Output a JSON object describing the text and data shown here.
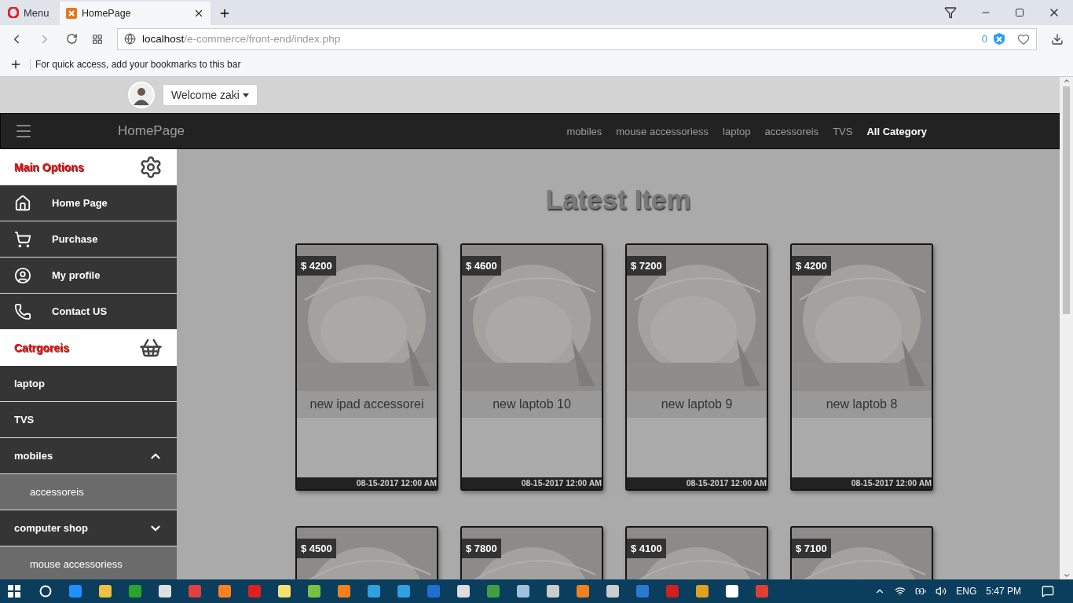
{
  "browser": {
    "menu_label": "Menu",
    "tab": {
      "title": "HomePage"
    },
    "address": {
      "host": "localhost",
      "path": "/e-commerce/front-end/index.php"
    },
    "blocked_count": "0",
    "bookmarks_hint": "For quick access, add your bookmarks to this bar"
  },
  "user_menu": {
    "label": "Welcome zaki"
  },
  "navbar": {
    "brand": "HomePage",
    "links": [
      {
        "label": "mobiles",
        "selected": false
      },
      {
        "label": "mouse accessoriess",
        "selected": false
      },
      {
        "label": "laptop",
        "selected": false
      },
      {
        "label": "accessoreis",
        "selected": false
      },
      {
        "label": "TVS",
        "selected": false
      },
      {
        "label": "All Category",
        "selected": true
      }
    ]
  },
  "sidebar": [
    {
      "kind": "heading",
      "label": "Main Options"
    },
    {
      "kind": "option",
      "label": "Home Page"
    },
    {
      "kind": "option",
      "label": "Purchase"
    },
    {
      "kind": "option",
      "label": "My profile"
    },
    {
      "kind": "option",
      "label": "Contact US"
    },
    {
      "kind": "heading",
      "label": "Catrgoreis"
    },
    {
      "kind": "category",
      "label": "laptop"
    },
    {
      "kind": "category",
      "label": "TVS"
    },
    {
      "kind": "category",
      "label": "mobiles",
      "expanded": true
    },
    {
      "kind": "subcategory",
      "label": "accessoreis"
    },
    {
      "kind": "category",
      "label": "computer shop",
      "expanded": false
    },
    {
      "kind": "subcategory",
      "label": "mouse accessoriess"
    }
  ],
  "content": {
    "title": "Latest Item",
    "rows": [
      [
        {
          "price": "$ 4200",
          "name": "new ipad accessorei",
          "date": "08-15-2017 12:00 AM"
        },
        {
          "price": "$ 4600",
          "name": "new laptob 10",
          "date": "08-15-2017 12:00 AM"
        },
        {
          "price": "$ 7200",
          "name": "new laptob 9",
          "date": "08-15-2017 12:00 AM"
        },
        {
          "price": "$ 4200",
          "name": "new laptob 8",
          "date": "08-15-2017 12:00 AM"
        }
      ],
      [
        {
          "price": "$ 4500"
        },
        {
          "price": "$ 7800"
        },
        {
          "price": "$ 4100"
        },
        {
          "price": "$ 7100"
        }
      ]
    ]
  },
  "taskbar": {
    "language": "ENG",
    "time": "5:47 PM"
  }
}
